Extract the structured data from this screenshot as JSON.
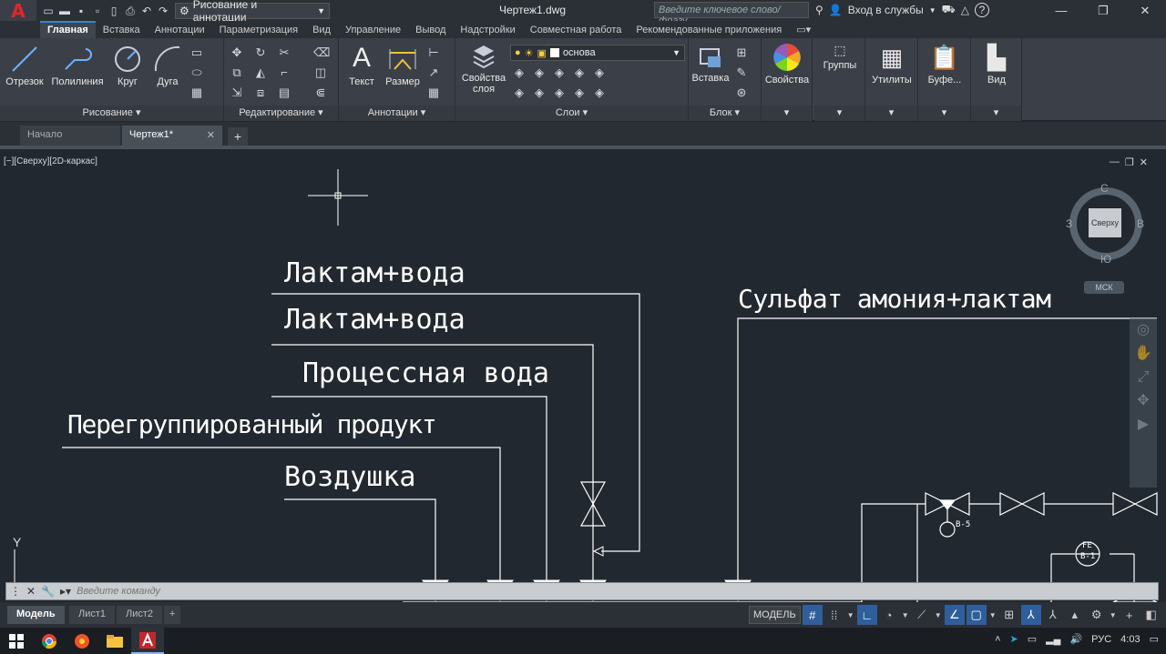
{
  "titlebar": {
    "logo": "A",
    "workspace": "Рисование и аннотации",
    "doc_title": "Чертеж1.dwg",
    "search_placeholder": "Введите ключевое слово/фразу",
    "signin": "Вход в службы"
  },
  "ribbon_tabs": [
    "Главная",
    "Вставка",
    "Аннотации",
    "Параметризация",
    "Вид",
    "Управление",
    "Вывод",
    "Надстройки",
    "Совместная работа",
    "Рекомендованные приложения"
  ],
  "ribbon": {
    "draw": {
      "title": "Рисование",
      "line": "Отрезок",
      "polyline": "Полилиния",
      "circle": "Круг",
      "arc": "Дуга"
    },
    "modify": {
      "title": "Редактирование"
    },
    "annotation": {
      "title": "Аннотации",
      "text": "Текст",
      "dimension": "Размер"
    },
    "layers": {
      "title": "Слои",
      "props_line1": "Свойства",
      "props_line2": "слоя",
      "current_layer": "основа"
    },
    "block": {
      "title": "Блок",
      "insert": "Вставка"
    },
    "properties": "Свойства",
    "groups": "Группы",
    "utilities": "Утилиты",
    "clipboard": "Буфе...",
    "view": "Вид"
  },
  "doc_tabs": [
    {
      "label": "Начало",
      "active": false
    },
    {
      "label": "Чертеж1*",
      "active": true
    }
  ],
  "viewport": {
    "label": "[−][Сверху][2D-каркас]",
    "viewcube": {
      "north": "С",
      "south": "Ю",
      "west": "З",
      "east": "В",
      "face": "Сверху",
      "ucs": "МСК"
    }
  },
  "drawing": {
    "labels": [
      "Лактам+вода",
      "Лактам+вода",
      "Процессная вода",
      "Перегруппированный продукт",
      "Воздушка",
      "Сульфат амония+лактам"
    ],
    "tags": [
      "В-5",
      "FE",
      "В-1"
    ]
  },
  "ucs_y": "Y",
  "command": {
    "placeholder": "Введите команду"
  },
  "layout_tabs": [
    {
      "label": "Модель",
      "active": true
    },
    {
      "label": "Лист1",
      "active": false
    },
    {
      "label": "Лист2",
      "active": false
    }
  ],
  "status": {
    "model": "МОДЕЛЬ"
  },
  "tray": {
    "lang": "РУС",
    "time": "4:03"
  }
}
